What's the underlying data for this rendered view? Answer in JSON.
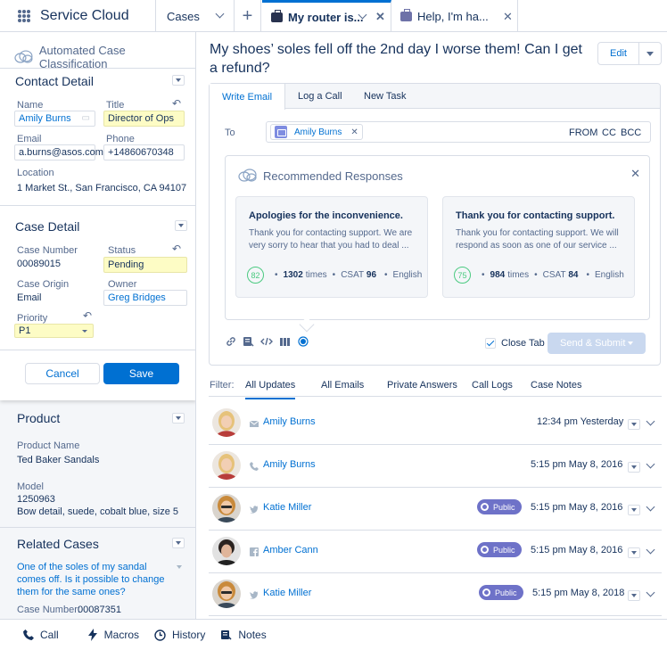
{
  "app": {
    "name": "Service Cloud"
  },
  "nav_tabs": {
    "cases": "Cases",
    "tab1": "My router is...",
    "tab2": "Help, I'm ha..."
  },
  "left": {
    "card_title": "Automated Case Classification",
    "contact": {
      "title": "Contact Detail",
      "name_label": "Name",
      "name_value": "Amily Burns",
      "title_label": "Title",
      "title_value": "Director of Ops",
      "email_label": "Email",
      "email_value": "a.burns@asos.com",
      "phone_label": "Phone",
      "phone_value": "+14860670348",
      "location_label": "Location",
      "location_value": "1 Market St., San Francisco, CA 94107"
    },
    "case": {
      "title": "Case Detail",
      "number_label": "Case Number",
      "number_value": "00089015",
      "status_label": "Status",
      "status_value": "Pending",
      "origin_label": "Case Origin",
      "origin_value": "Email",
      "owner_label": "Owner",
      "owner_value": "Greg Bridges",
      "priority_label": "Priority",
      "priority_value": "P1"
    },
    "cancel": "Cancel",
    "save": "Save",
    "product": {
      "title": "Product",
      "name_label": "Product Name",
      "name_value": "Ted Baker Sandals",
      "model_label": "Model",
      "model_value": "1250963",
      "model_desc": "Bow detail, suede, cobalt blue, size 5"
    },
    "related": {
      "title": "Related Cases",
      "text": "One of the soles of my sandal comes off. Is it possible to change them for the same ones?",
      "number_label": "Case Number:",
      "number_value": "00087351"
    }
  },
  "case_title": "My shoes’ soles fell off the 2nd day I worse them! Can I get a refund?",
  "edit_label": "Edit",
  "composer": {
    "tabs": [
      "Write Email",
      "Log a Call",
      "New Task"
    ],
    "to_label": "To",
    "recipient": "Amily Burns",
    "from": "FROM",
    "cc": "CC",
    "bcc": "BCC",
    "recs_title": "Recommended Responses",
    "cards": [
      {
        "title": "Apologies for the inconvenience.",
        "text": "Thank you for contacting support. We are very sorry to hear that you had to deal ...",
        "score": "82",
        "times": "1302",
        "times_unit": "times",
        "csat_label": "CSAT",
        "csat": "96",
        "lang": "English"
      },
      {
        "title": "Thank you for contacting support.",
        "text": "Thank you for contacting support. We will respond as soon as one of our service ...",
        "score": "75",
        "times": "984",
        "times_unit": "times",
        "csat_label": "CSAT",
        "csat": "84",
        "lang": "English"
      }
    ],
    "close_tab": "Close Tab",
    "send": "Send & Submit"
  },
  "filter": {
    "label": "Filter:",
    "tabs": [
      "All Updates",
      "All Emails",
      "Private Answers",
      "Call Logs",
      "Case Notes"
    ]
  },
  "feed": [
    {
      "name": "Amily Burns",
      "channel": "email-icon",
      "time": "12:34 pm Yesterday",
      "badge": ""
    },
    {
      "name": "Amily Burns",
      "channel": "phone-icon",
      "time": "5:15 pm May 8, 2016",
      "badge": ""
    },
    {
      "name": "Katie Miller",
      "channel": "twitter-icon",
      "time": "5:15 pm May 8, 2016",
      "badge": "Public"
    },
    {
      "name": "Amber Cann",
      "channel": "facebook-icon",
      "time": "5:15 pm May 8, 2016",
      "badge": "Public"
    },
    {
      "name": "Katie Miller",
      "channel": "twitter-icon",
      "time": "5:15 pm May 8, 2018",
      "badge": "Public"
    }
  ],
  "utility": {
    "call": "Call",
    "macros": "Macros",
    "history": "History",
    "notes": "Notes"
  },
  "colors": {
    "brand": "#0070d2",
    "text": "#16325c",
    "muted": "#54698d",
    "highlight": "#fdfcc5",
    "badge": "#6e72c8",
    "score": "#4bca81"
  }
}
